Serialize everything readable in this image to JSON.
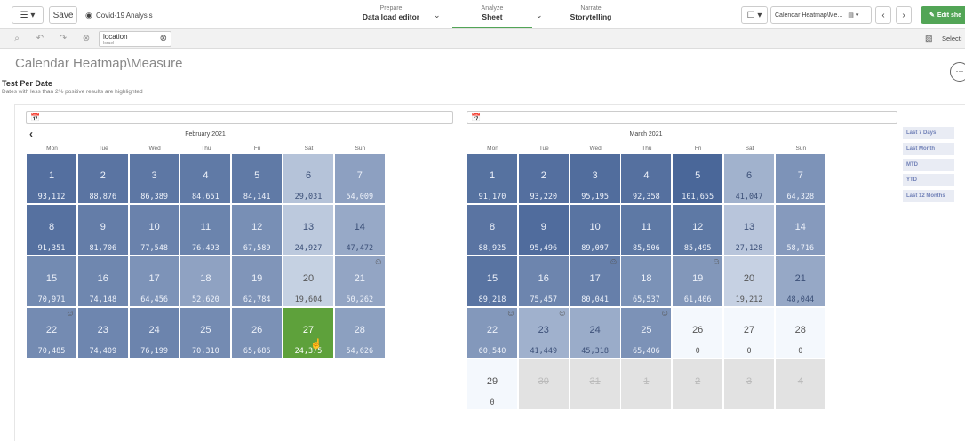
{
  "toolbar": {
    "menu_icon": "menu-icon",
    "save_label": "Save",
    "app_name": "Covid-19 Analysis",
    "tabs": [
      {
        "top": "Prepare",
        "label": "Data load editor"
      },
      {
        "top": "Analyze",
        "label": "Sheet"
      },
      {
        "top": "Narrate",
        "label": "Storytelling"
      }
    ],
    "sheet_name": "Calendar Heatmap\\Me...",
    "edit_label": "Edit she"
  },
  "selections": {
    "field": "location",
    "value": "Israel",
    "selections_label": "Selecti"
  },
  "sheet": {
    "title": "Calendar Heatmap\\Measure",
    "chart_title": "Test Per Date",
    "chart_subtitle": "Dates with less than 2% positive results are highlighted"
  },
  "weekdays": [
    "Mon",
    "Tue",
    "Wed",
    "Thu",
    "Fri",
    "Sat",
    "Sun"
  ],
  "february": {
    "label": "February 2021",
    "days": [
      {
        "d": "1",
        "v": "93,112"
      },
      {
        "d": "2",
        "v": "88,876"
      },
      {
        "d": "3",
        "v": "86,389"
      },
      {
        "d": "4",
        "v": "84,651"
      },
      {
        "d": "5",
        "v": "84,141"
      },
      {
        "d": "6",
        "v": "29,031"
      },
      {
        "d": "7",
        "v": "54,009"
      },
      {
        "d": "8",
        "v": "91,351"
      },
      {
        "d": "9",
        "v": "81,706"
      },
      {
        "d": "10",
        "v": "77,548"
      },
      {
        "d": "11",
        "v": "76,493"
      },
      {
        "d": "12",
        "v": "67,589"
      },
      {
        "d": "13",
        "v": "24,927"
      },
      {
        "d": "14",
        "v": "47,472"
      },
      {
        "d": "15",
        "v": "70,971"
      },
      {
        "d": "16",
        "v": "74,148"
      },
      {
        "d": "17",
        "v": "64,456"
      },
      {
        "d": "18",
        "v": "52,620"
      },
      {
        "d": "19",
        "v": "62,784"
      },
      {
        "d": "20",
        "v": "19,604"
      },
      {
        "d": "21",
        "v": "50,262"
      },
      {
        "d": "22",
        "v": "70,485"
      },
      {
        "d": "23",
        "v": "74,409"
      },
      {
        "d": "24",
        "v": "76,199"
      },
      {
        "d": "25",
        "v": "70,310"
      },
      {
        "d": "26",
        "v": "65,686"
      },
      {
        "d": "27",
        "v": "24,375"
      },
      {
        "d": "28",
        "v": "54,626"
      }
    ]
  },
  "march": {
    "label": "March 2021",
    "days": [
      {
        "d": "1",
        "v": "91,170"
      },
      {
        "d": "2",
        "v": "93,220"
      },
      {
        "d": "3",
        "v": "95,195"
      },
      {
        "d": "4",
        "v": "92,358"
      },
      {
        "d": "5",
        "v": "101,655"
      },
      {
        "d": "6",
        "v": "41,047"
      },
      {
        "d": "7",
        "v": "64,328"
      },
      {
        "d": "8",
        "v": "88,925"
      },
      {
        "d": "9",
        "v": "95,496"
      },
      {
        "d": "10",
        "v": "89,097"
      },
      {
        "d": "11",
        "v": "85,506"
      },
      {
        "d": "12",
        "v": "85,495"
      },
      {
        "d": "13",
        "v": "27,128"
      },
      {
        "d": "14",
        "v": "58,716"
      },
      {
        "d": "15",
        "v": "89,218"
      },
      {
        "d": "16",
        "v": "75,457"
      },
      {
        "d": "17",
        "v": "80,041"
      },
      {
        "d": "18",
        "v": "65,537"
      },
      {
        "d": "19",
        "v": "61,406"
      },
      {
        "d": "20",
        "v": "19,212"
      },
      {
        "d": "21",
        "v": "48,044"
      },
      {
        "d": "22",
        "v": "60,540"
      },
      {
        "d": "23",
        "v": "41,449"
      },
      {
        "d": "24",
        "v": "45,318"
      },
      {
        "d": "25",
        "v": "65,406"
      },
      {
        "d": "26",
        "v": "0"
      },
      {
        "d": "27",
        "v": "0"
      },
      {
        "d": "28",
        "v": "0"
      },
      {
        "d": "29",
        "v": "0"
      },
      {
        "d": "30",
        "v": ""
      },
      {
        "d": "31",
        "v": ""
      },
      {
        "d": "1",
        "v": ""
      },
      {
        "d": "2",
        "v": ""
      },
      {
        "d": "3",
        "v": ""
      },
      {
        "d": "4",
        "v": ""
      }
    ]
  },
  "highlighted": {
    "feb": [
      20,
      21
    ],
    "mar": [
      16,
      18,
      21,
      22,
      24
    ]
  },
  "selected_feb_day": 27,
  "ranges": [
    "Last 7 Days",
    "Last Month",
    "MTD",
    "YTD",
    "Last 12 Months"
  ],
  "colors": {
    "max": "#4a6799",
    "min": "#eef4fb",
    "selected": "#5ea13b",
    "accent": "#52a556"
  }
}
